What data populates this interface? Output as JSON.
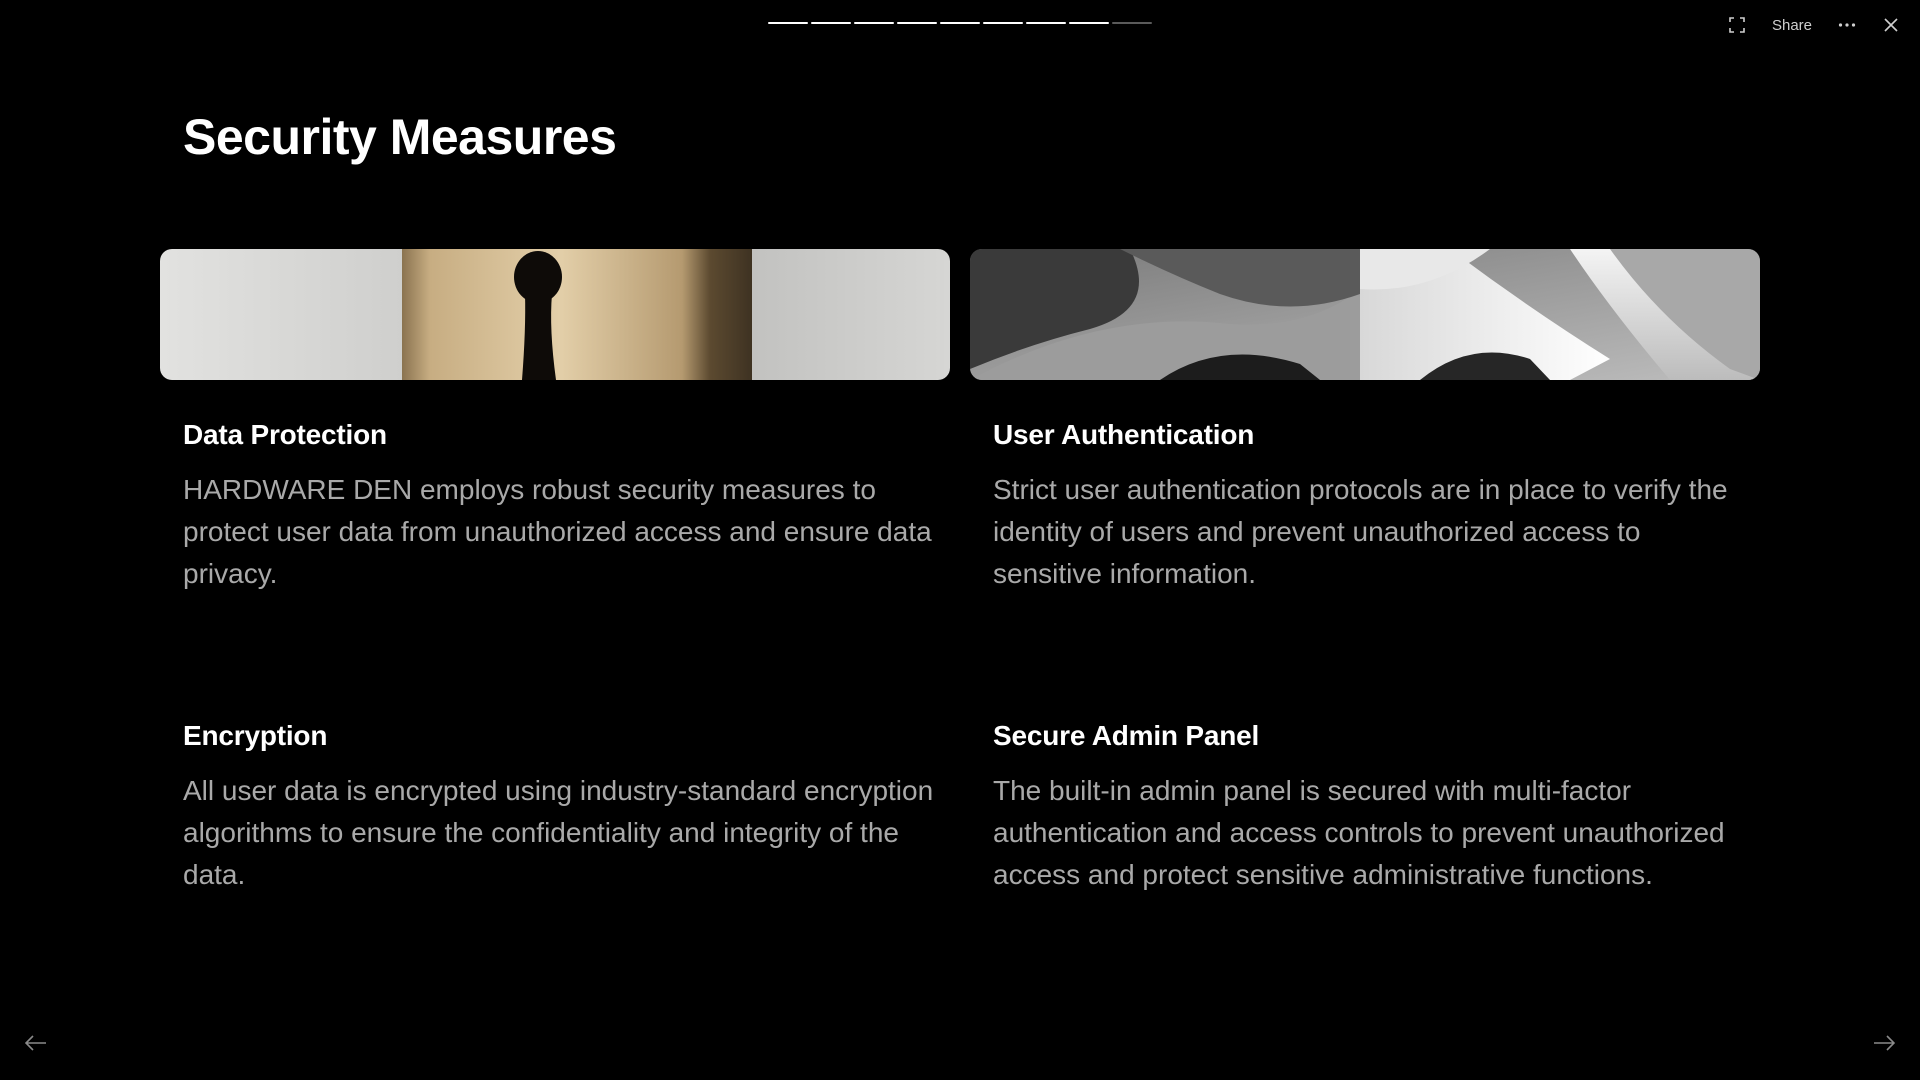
{
  "progress": {
    "total": 9,
    "current": 8
  },
  "toolbar": {
    "fullscreen_icon": "fullscreen-icon",
    "share_label": "Share",
    "more_icon": "more-icon",
    "close_icon": "close-icon"
  },
  "slide": {
    "title": "Security Measures",
    "images": [
      {
        "icon": "keyhole-image"
      },
      {
        "icon": "abstract-sculpture-image"
      }
    ],
    "sections": [
      {
        "heading": "Data Protection",
        "body": "HARDWARE DEN employs robust security measures to protect user data from unauthorized access and ensure data privacy."
      },
      {
        "heading": "User Authentication",
        "body": "Strict user authentication protocols are in place to verify the identity of users and prevent unauthorized access to sensitive information."
      },
      {
        "heading": "Encryption",
        "body": "All user data is encrypted using industry-standard encryption algorithms to ensure the confidentiality and integrity of the data."
      },
      {
        "heading": "Secure Admin Panel",
        "body": "The built-in admin panel is secured with multi-factor authentication and access controls to prevent unauthorized access and protect sensitive administrative functions."
      }
    ]
  },
  "nav": {
    "prev_icon": "arrow-left-icon",
    "next_icon": "arrow-right-icon"
  },
  "colors": {
    "background": "#000000",
    "heading": "#ffffff",
    "body_text": "#a9a9a9"
  }
}
